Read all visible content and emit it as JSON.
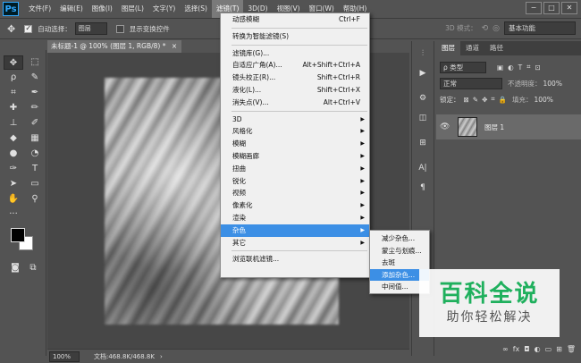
{
  "app": {
    "logo": "Ps"
  },
  "menubar": {
    "items": [
      "文件(F)",
      "编辑(E)",
      "图像(I)",
      "图层(L)",
      "文字(Y)",
      "选择(S)",
      "滤镜(T)",
      "3D(D)",
      "视图(V)",
      "窗口(W)",
      "帮助(H)"
    ],
    "active_index": 6
  },
  "window_controls": [
    "−",
    "□",
    "✕"
  ],
  "options_bar": {
    "auto_select_label": "自动选择：",
    "auto_select_value": "图层",
    "show_transform_label": "显示变换控件",
    "mode_3d_label": "3D 模式：",
    "workspace": "基本功能"
  },
  "document": {
    "tab_title": "未标题-1 @ 100% (图层 1, RGB/8) *",
    "close_glyph": "×",
    "zoom": "100%",
    "doc_info": "文档:468.8K/468.8K"
  },
  "filter_menu": {
    "items": [
      {
        "label": "动感模糊",
        "shortcut": "Ctrl+F"
      },
      {
        "sep": true
      },
      {
        "label": "转换为智能滤镜(S)"
      },
      {
        "sep": true
      },
      {
        "label": "滤镜库(G)..."
      },
      {
        "label": "自适应广角(A)...",
        "shortcut": "Alt+Shift+Ctrl+A"
      },
      {
        "label": "镜头校正(R)...",
        "shortcut": "Shift+Ctrl+R"
      },
      {
        "label": "液化(L)...",
        "shortcut": "Shift+Ctrl+X"
      },
      {
        "label": "消失点(V)...",
        "shortcut": "Alt+Ctrl+V"
      },
      {
        "sep": true
      },
      {
        "label": "3D",
        "submenu": true
      },
      {
        "label": "风格化",
        "submenu": true
      },
      {
        "label": "模糊",
        "submenu": true
      },
      {
        "label": "模糊画廊",
        "submenu": true
      },
      {
        "label": "扭曲",
        "submenu": true
      },
      {
        "label": "锐化",
        "submenu": true
      },
      {
        "label": "视频",
        "submenu": true
      },
      {
        "label": "像素化",
        "submenu": true
      },
      {
        "label": "渲染",
        "submenu": true
      },
      {
        "label": "杂色",
        "submenu": true,
        "highlighted": true
      },
      {
        "label": "其它",
        "submenu": true
      },
      {
        "sep": true
      },
      {
        "label": "浏览联机滤镜..."
      }
    ]
  },
  "noise_submenu": {
    "items": [
      {
        "label": "减少杂色..."
      },
      {
        "label": "蒙尘与划痕..."
      },
      {
        "label": "去斑"
      },
      {
        "label": "添加杂色...",
        "highlighted": true
      },
      {
        "label": "中间值..."
      }
    ]
  },
  "layers_panel": {
    "tabs": [
      "图层",
      "通道",
      "路径"
    ],
    "kind_filter": "ρ 类型",
    "blend_mode": "正常",
    "opacity_label": "不透明度：",
    "opacity_value": "100%",
    "lock_label": "锁定：",
    "fill_label": "填充：",
    "fill_value": "100%",
    "layer_name": "图层 1",
    "bottom_icons": [
      "∞",
      "fx",
      "◘",
      "◐",
      "▭",
      "⊞",
      "🗑"
    ]
  },
  "watermark": {
    "title": "百科全说",
    "subtitle": "助你轻松解决"
  }
}
